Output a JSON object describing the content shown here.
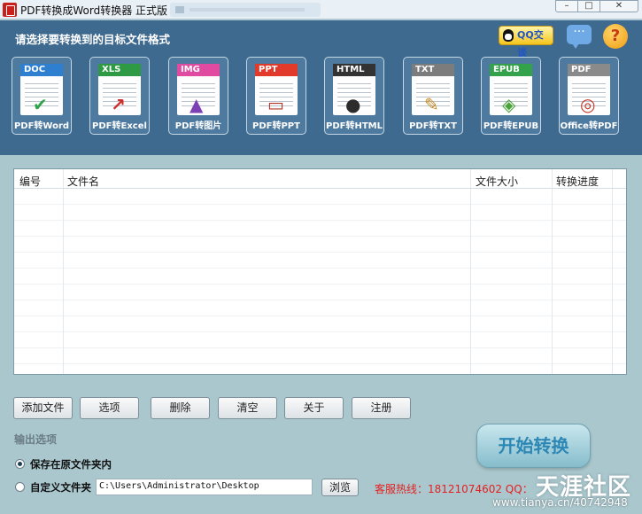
{
  "window": {
    "title": "PDF转换成Word转换器 正式版",
    "minimize": "–",
    "maximize": "□",
    "close": "✕"
  },
  "header": {
    "prompt": "请选择要转换到的目标文件格式",
    "qq_badge": "QQ交谈",
    "help_glyph": "?",
    "chat_glyph": "···"
  },
  "formats": [
    {
      "band": "DOC",
      "label": "PDF转Word",
      "band_color": "#2f7fd0",
      "glyph": "✔",
      "glyph_color": "#2fa24a"
    },
    {
      "band": "XLS",
      "label": "PDF转Excel",
      "band_color": "#2e9a43",
      "glyph": "↗",
      "glyph_color": "#d02a2a"
    },
    {
      "band": "IMG",
      "label": "PDF转图片",
      "band_color": "#e04aa0",
      "glyph": "▲",
      "glyph_color": "#7c3fb4"
    },
    {
      "band": "PPT",
      "label": "PDF转PPT",
      "band_color": "#e23a2a",
      "glyph": "▭",
      "glyph_color": "#b53226"
    },
    {
      "band": "HTML",
      "label": "PDF转HTML",
      "band_color": "#333333",
      "glyph": "●",
      "glyph_color": "#2c2c2c"
    },
    {
      "band": "TXT",
      "label": "PDF转TXT",
      "band_color": "#7c7c7c",
      "glyph": "✎",
      "glyph_color": "#c78a25"
    },
    {
      "band": "EPUB",
      "label": "PDF转EPUB",
      "band_color": "#33a24a",
      "glyph": "◈",
      "glyph_color": "#4aa43a"
    },
    {
      "band": "PDF",
      "label": "Office转PDF",
      "band_color": "#8a8a8a",
      "glyph": "◎",
      "glyph_color": "#c63a2e"
    }
  ],
  "table": {
    "columns": [
      "编号",
      "文件名",
      "文件大小",
      "转换进度"
    ],
    "rows": []
  },
  "actions": [
    "添加文件",
    "选项",
    "删除",
    "清空",
    "关于",
    "注册"
  ],
  "output": {
    "section_title": "输出选项",
    "option_original": "保存在原文件夹内",
    "option_custom": "自定义文件夹",
    "selected": "original",
    "custom_path": "C:\\Users\\Administrator\\Desktop",
    "browse_label": "浏览"
  },
  "start_button": "开始转换",
  "hotline": "客服热线：18121074602 QQ：",
  "watermark": {
    "main": "天涯社区",
    "url": "www.tianya.cn/40742948"
  },
  "colors": {
    "header_bg": "#3f6a8f",
    "body_bg": "#a9c7cd",
    "hotline": "#e52020",
    "start_text": "#2d87b5"
  }
}
